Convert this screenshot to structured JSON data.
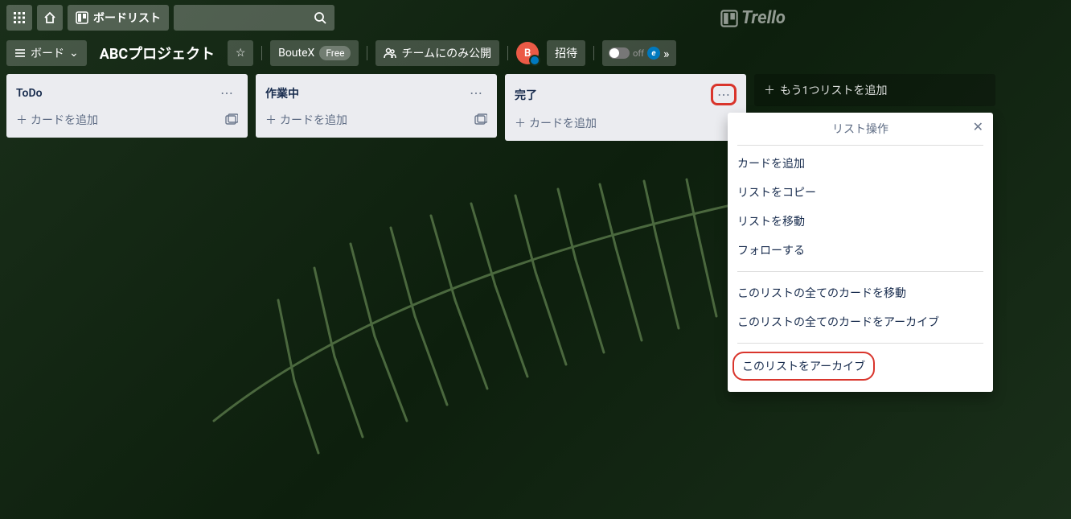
{
  "app": {
    "logo_text": "Trello"
  },
  "topnav": {
    "boardlist_label": "ボードリスト",
    "search_placeholder": ""
  },
  "boardbar": {
    "board_switcher": "ボード",
    "title": "ABCプロジェクト",
    "team_name": "BouteX",
    "plan_badge": "Free",
    "visibility": "チームにのみ公開",
    "invite": "招待",
    "avatar_initial": "B",
    "toggle_label": "off"
  },
  "lists": [
    {
      "title": "ToDo",
      "add_card": "カードを追加",
      "has_template_icon": true
    },
    {
      "title": "作業中",
      "add_card": "カードを追加",
      "has_template_icon": true
    },
    {
      "title": "完了",
      "add_card": "カードを追加",
      "has_template_icon": false,
      "menu_highlighted": true
    }
  ],
  "add_list_label": "もう1つリストを追加",
  "popover": {
    "title": "リスト操作",
    "sections": [
      [
        "カードを追加",
        "リストをコピー",
        "リストを移動",
        "フォローする"
      ],
      [
        "このリストの全てのカードを移動",
        "このリストの全てのカードをアーカイブ"
      ],
      [
        "このリストをアーカイブ"
      ]
    ],
    "highlighted_item": "このリストをアーカイブ"
  }
}
